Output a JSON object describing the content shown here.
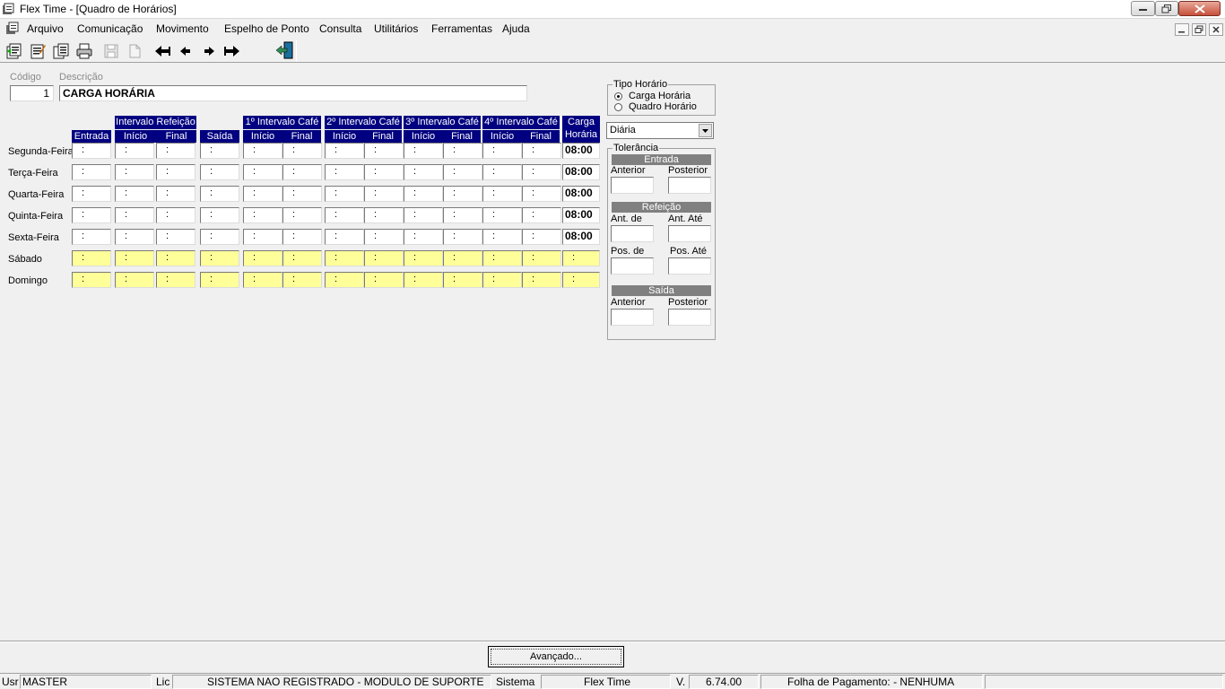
{
  "window": {
    "title": "Flex Time - [Quadro de Horários]"
  },
  "menu": [
    "Arquivo",
    "Comunicação",
    "Movimento",
    "Espelho de Ponto",
    "Consulta",
    "Utilitários",
    "Ferramentas",
    "Ajuda"
  ],
  "toolbar_icons": [
    "new-icon",
    "edit-icon",
    "copy-icon",
    "print-icon",
    "save-icon",
    "cancel-icon",
    "first-record-icon",
    "previous-record-icon",
    "next-record-icon",
    "last-record-icon",
    "exit-icon"
  ],
  "form": {
    "codigo_label": "Código",
    "descricao_label": "Descrição",
    "codigo": "1",
    "descricao": "CARGA HORÁRIA"
  },
  "grid": {
    "group_headers": {
      "refeicao": "Intervalo Refeição",
      "cafe1": "1º Intervalo Café",
      "cafe2": "2º Intervalo Café",
      "cafe3": "3º Intervalo Café",
      "cafe4": "4º Intervalo Café",
      "carga": "Carga",
      "carga2": "Horária"
    },
    "sub_headers": {
      "entrada": "Entrada",
      "inicio": "Início",
      "final": "Final",
      "saida": "Saída"
    },
    "empty_time": ":",
    "days": [
      {
        "name": "Segunda-Feira",
        "total": "08:00",
        "weekend": false
      },
      {
        "name": "Terça-Feira",
        "total": "08:00",
        "weekend": false
      },
      {
        "name": "Quarta-Feira",
        "total": "08:00",
        "weekend": false
      },
      {
        "name": "Quinta-Feira",
        "total": "08:00",
        "weekend": false
      },
      {
        "name": "Sexta-Feira",
        "total": "08:00",
        "weekend": false
      },
      {
        "name": "Sábado",
        "total": ":",
        "weekend": true
      },
      {
        "name": "Domingo",
        "total": ":",
        "weekend": true
      }
    ]
  },
  "tipo_horario": {
    "title": "Tipo Horário",
    "options": [
      "Carga Horária",
      "Quadro Horário"
    ],
    "selected": "Carga Horária"
  },
  "frequencia": {
    "value": "Diária"
  },
  "tolerancia": {
    "title": "Tolerância",
    "entrada": {
      "title": "Entrada",
      "left": "Anterior",
      "right": "Posterior"
    },
    "refeicao": {
      "title": "Refeição",
      "left": "Ant. de",
      "right": "Ant. Até",
      "left2": "Pos. de",
      "right2": "Pos. Até"
    },
    "saida": {
      "title": "Saída",
      "left": "Anterior",
      "right": "Posterior"
    }
  },
  "advanced_button": "Avançado...",
  "status": {
    "usr_label": "Usr",
    "usr": "MASTER",
    "lic_label": "Lic",
    "lic": "SISTEMA NAO REGISTRADO - MODULO DE SUPORTE",
    "sistema_label": "Sistema",
    "sistema": "Flex Time",
    "versao_label": "V.",
    "versao": "6.74.00",
    "folha": "Folha de Pagamento:  - NENHUMA"
  }
}
